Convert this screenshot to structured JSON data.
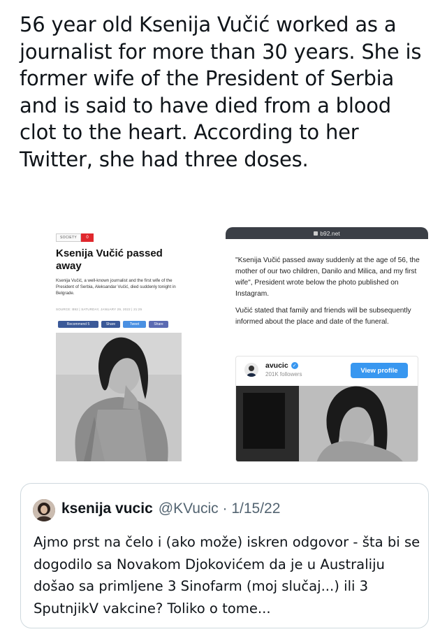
{
  "tweet": {
    "text": "56 year old Ksenija Vučić worked as a journalist for more than 30 years. She is former wife of the President of Serbia and is said to have died from a blood clot to the heart. According to her Twitter, she had three doses."
  },
  "left_article": {
    "category": "SOCIETY",
    "category_count": "0",
    "title": "Ksenija Vučić passed away",
    "description": "Ksenija Vučić, a well-known journalist and the first wife of the President of Serbia, Aleksandar Vučić, died suddenly tonight in Belgrade.",
    "source": "SOURCE: B92 | SATURDAY, JANUARY 29, 2022 | 21:25",
    "share_buttons": {
      "recommend": "Recommend 5",
      "share": "Share",
      "tweet": "Tweet",
      "whatsapp": "Share"
    }
  },
  "right_article": {
    "url": "b92.net",
    "quote": "\"Ksenija Vučić passed away suddenly at the age of 56, the mother of our two children, Danilo and Milica, and my first wife\", President wrote below the photo published on Instagram.",
    "paragraph": "Vučić stated that family and friends will be subsequently informed about the place and date of the funeral.",
    "instagram": {
      "username": "avucic",
      "followers": "201K followers",
      "view_profile": "View profile"
    }
  },
  "quoted_tweet": {
    "name": "ksenija vucic",
    "handle": "@KVucic",
    "separator": "·",
    "date": "1/15/22",
    "text": "Ajmo prst na čelo i (ako može) iskren odgovor - šta bi se dogodilo sa Novakom Djokovićem da je u Australiju došao sa primljene 3 Sinofarm (moj slučaj...) ili 3 SputnjikV vakcine? Toliko o tome..."
  }
}
